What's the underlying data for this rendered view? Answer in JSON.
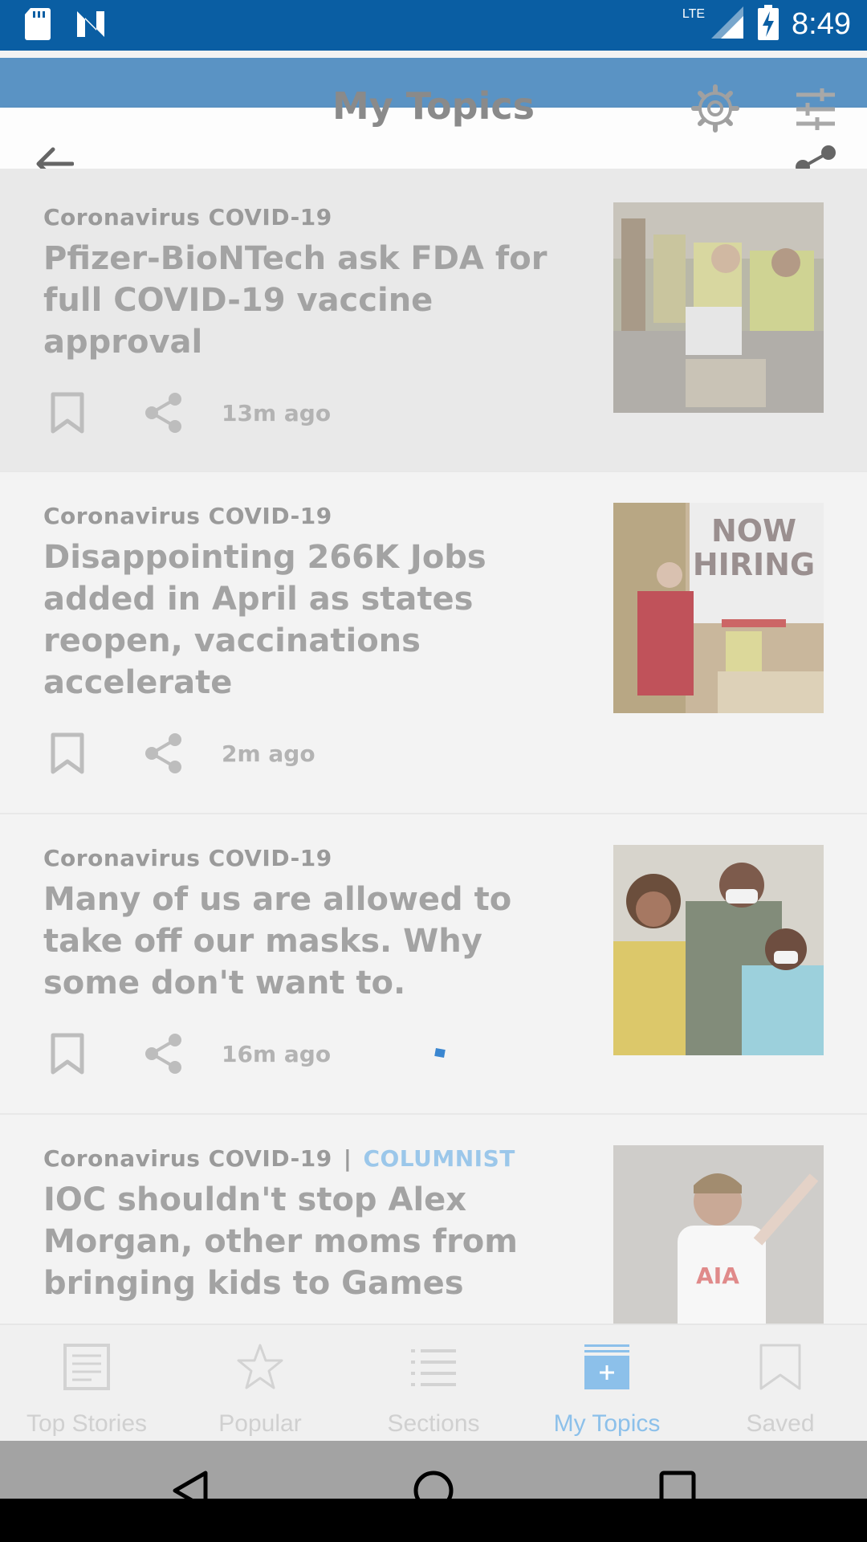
{
  "status_bar": {
    "time": "8:49",
    "network": "LTE",
    "icons": [
      "sd-card-icon",
      "n-logo-icon",
      "signal-icon",
      "battery-charging-icon"
    ]
  },
  "header": {
    "title": "My Topics",
    "icons": [
      "back-arrow-icon",
      "share-icon",
      "settings-gear-icon",
      "filter-sliders-icon"
    ]
  },
  "articles": [
    {
      "topic": "Coronavirus COVID-19",
      "label": "",
      "headline_lines": [
        "Pfizer-BioNTech ask FDA for",
        "full COVID-19 vaccine",
        "approval"
      ],
      "time_ago": "13m ago",
      "image": "warehouse-workers-photo"
    },
    {
      "topic": "Coronavirus COVID-19",
      "label": "",
      "headline_lines": [
        "Disappointing 266K Jobs",
        "added in April as states",
        "reopen, vaccinations",
        "accelerate"
      ],
      "time_ago": "2m ago",
      "image": "now-hiring-sign-photo",
      "image_text": [
        "NOW",
        "HIRING"
      ]
    },
    {
      "topic": "Coronavirus COVID-19",
      "label": "",
      "headline_lines": [
        "Many of us are allowed to",
        "take off our masks. Why",
        "some don't want to."
      ],
      "time_ago": "16m ago",
      "image": "family-masks-photo"
    },
    {
      "topic": "Coronavirus COVID-19",
      "separator": "|",
      "label": "COLUMNIST",
      "headline_lines": [
        "IOC shouldn't stop Alex",
        "Morgan, other moms from",
        "bringing kids to Games"
      ],
      "time_ago": "",
      "image": "soccer-player-photo",
      "image_text": [
        "AIA"
      ]
    }
  ],
  "bottom_nav": [
    {
      "label": "Top Stories",
      "icon": "newspaper-icon",
      "active": false
    },
    {
      "label": "Popular",
      "icon": "star-icon",
      "active": false
    },
    {
      "label": "Sections",
      "icon": "list-icon",
      "active": false
    },
    {
      "label": "My Topics",
      "icon": "add-topic-icon",
      "active": true
    },
    {
      "label": "Saved",
      "icon": "bookmark-icon",
      "active": false
    }
  ],
  "colors": {
    "status_bar": "#0a5ea3",
    "header_band": "#5a93c4",
    "active_tab": "#8cc0ea",
    "columnist": "#9bc7ea"
  }
}
